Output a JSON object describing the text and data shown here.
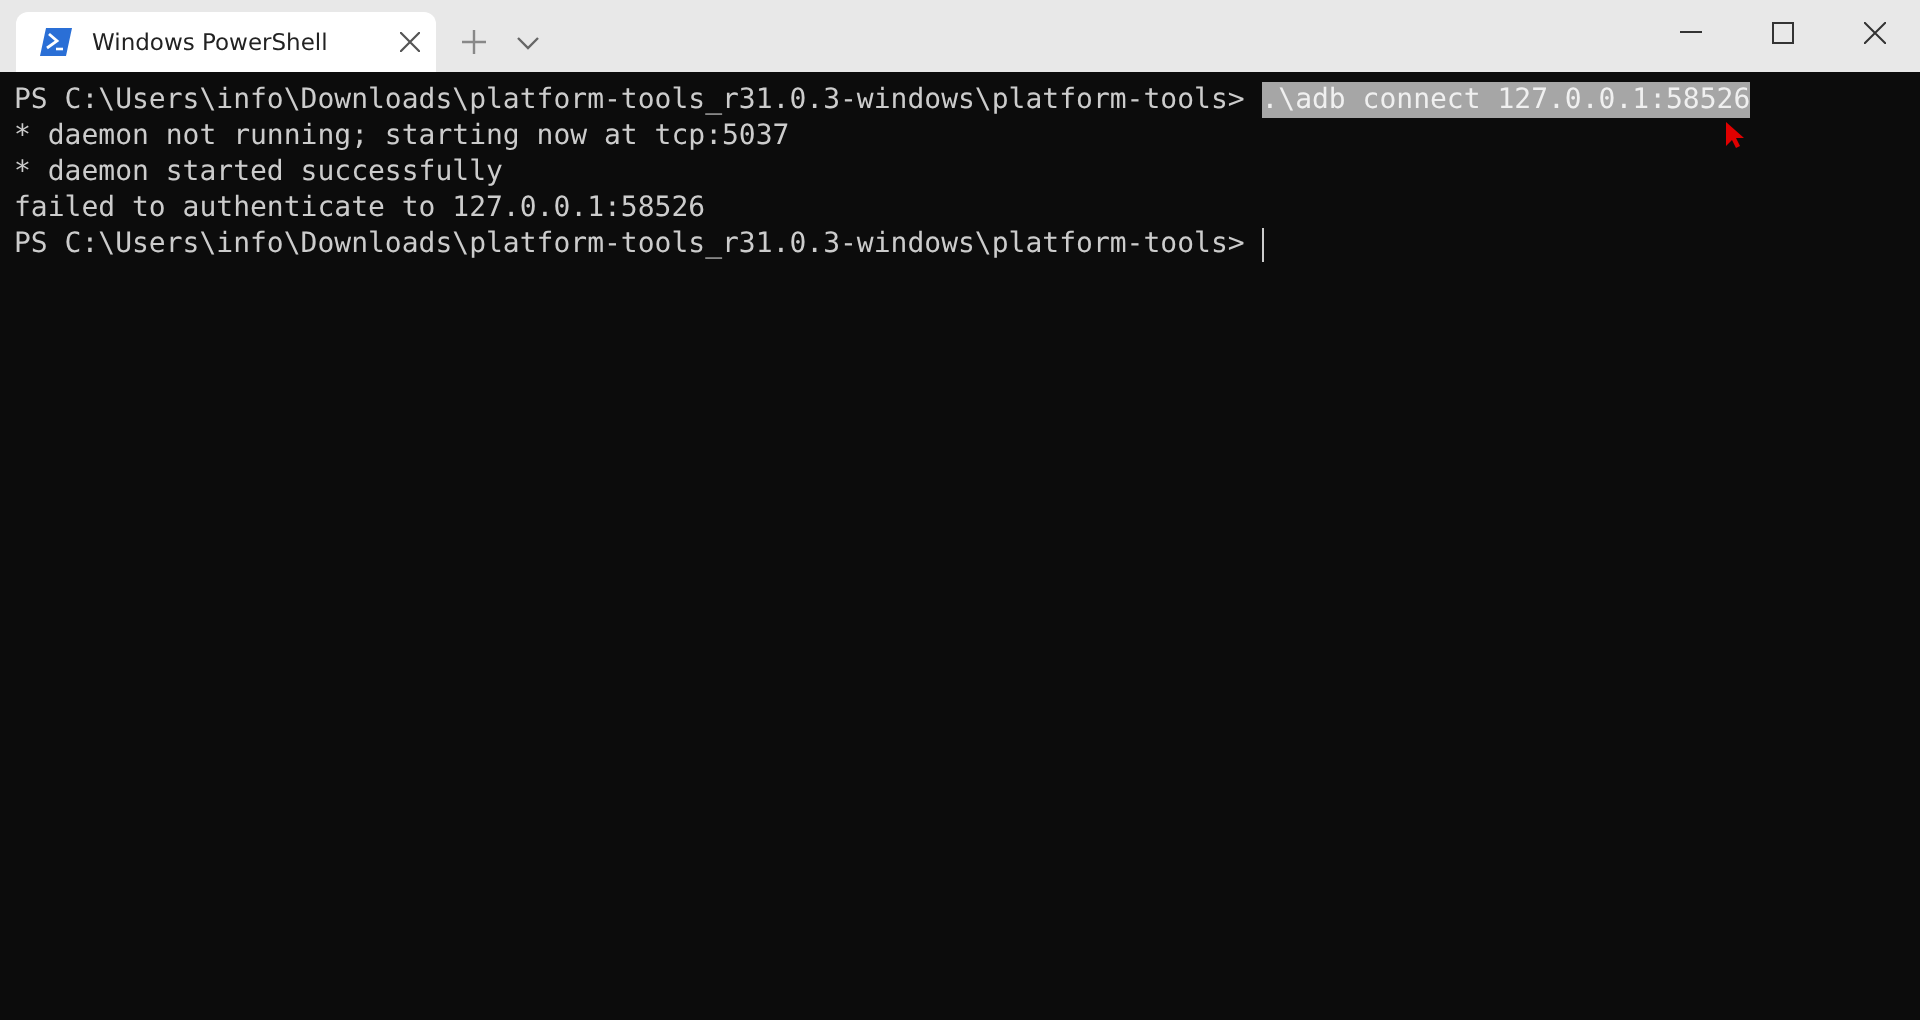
{
  "tabs": [
    {
      "title": "Windows PowerShell",
      "selected": true
    }
  ],
  "terminal": {
    "lines": [
      {
        "kind": "prompt",
        "prompt": "PS C:\\Users\\info\\Downloads\\platform-tools_r31.0.3-windows\\platform-tools>",
        "command": ".\\adb connect 127.0.0.1:58526",
        "selected": true
      },
      {
        "kind": "output",
        "text": "* daemon not running; starting now at tcp:5037"
      },
      {
        "kind": "output",
        "text": "* daemon started successfully"
      },
      {
        "kind": "output",
        "text": "failed to authenticate to 127.0.0.1:58526"
      },
      {
        "kind": "prompt",
        "prompt": "PS C:\\Users\\info\\Downloads\\platform-tools_r31.0.3-windows\\platform-tools>",
        "cursor": true
      }
    ]
  }
}
